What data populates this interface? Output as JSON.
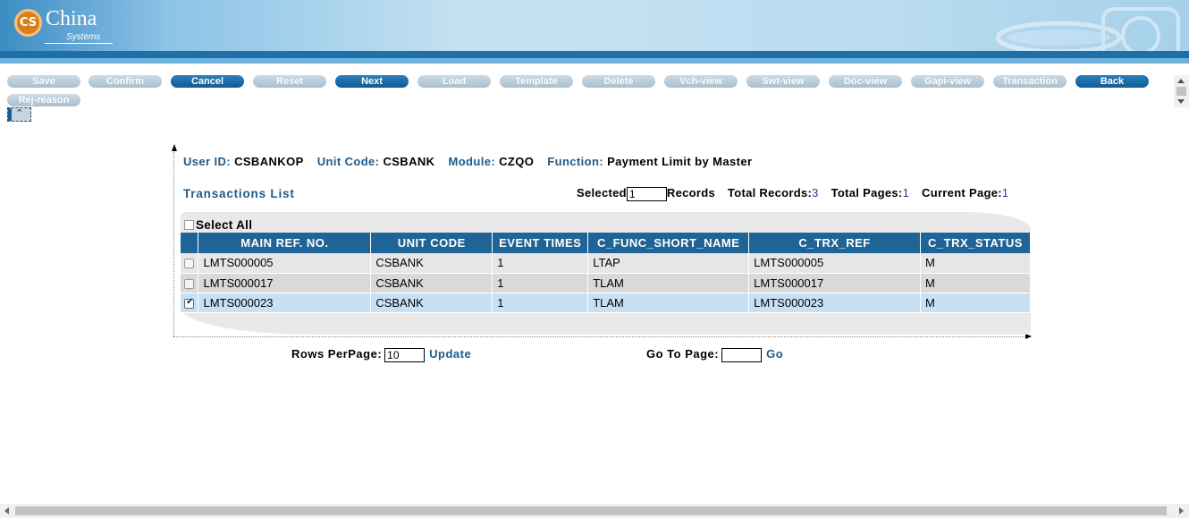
{
  "brand": {
    "badge_text": "CS",
    "name": "China",
    "sub": "Systems",
    "colors": {
      "banner_dark": "#1f6fa8",
      "banner_light": "#c6e2f2",
      "accent_orange": "#d87f1c"
    }
  },
  "toolbar": {
    "buttons": [
      {
        "label": "Save",
        "active": false
      },
      {
        "label": "Confirm",
        "active": false
      },
      {
        "label": "Cancel",
        "active": true
      },
      {
        "label": "Reset",
        "active": false
      },
      {
        "label": "Next",
        "active": true
      },
      {
        "label": "Load",
        "active": false
      },
      {
        "label": "Template",
        "active": false
      },
      {
        "label": "Delete",
        "active": false
      },
      {
        "label": "Vch-view",
        "active": false
      },
      {
        "label": "Swt-view",
        "active": false
      },
      {
        "label": "Doc-view",
        "active": false
      },
      {
        "label": "Gapi-view",
        "active": false
      },
      {
        "label": "Transaction",
        "active": false
      },
      {
        "label": "Back",
        "active": true
      },
      {
        "label": "Rej-reason",
        "active": false
      }
    ],
    "collapse_icon": "chevron-double-up-icon"
  },
  "info": {
    "user_id_label": "User ID:",
    "user_id": "CSBANKOP",
    "unit_code_label": "Unit Code:",
    "unit_code": "CSBANK",
    "module_label": "Module:",
    "module": "CZQO",
    "function_label": "Function:",
    "function": "Payment Limit by Master"
  },
  "list": {
    "title": "Transactions List",
    "selected_label": "Selected",
    "selected_value": "1",
    "records_label": "Records",
    "total_records_label": "Total Records:",
    "total_records": "3",
    "total_pages_label": "Total Pages:",
    "total_pages": "1",
    "current_page_label": "Current Page:",
    "current_page": "1",
    "select_all_label": "Select All",
    "columns": [
      "MAIN REF. NO.",
      "UNIT CODE",
      "EVENT TIMES",
      "C_FUNC_SHORT_NAME",
      "C_TRX_REF",
      "C_TRX_STATUS"
    ],
    "rows": [
      {
        "checked": false,
        "cells": [
          "LMTS000005",
          "CSBANK",
          "1",
          "LTAP",
          "LMTS000005",
          "M"
        ]
      },
      {
        "checked": false,
        "cells": [
          "LMTS000017",
          "CSBANK",
          "1",
          "TLAM",
          "LMTS000017",
          "M"
        ]
      },
      {
        "checked": true,
        "cells": [
          "LMTS000023",
          "CSBANK",
          "1",
          "TLAM",
          "LMTS000023",
          "M"
        ]
      }
    ]
  },
  "pager": {
    "rows_per_page_label": "Rows PerPage:",
    "rows_per_page_value": "10",
    "update_label": "Update",
    "go_to_page_label": "Go To Page:",
    "go_to_page_value": "",
    "go_label": "Go"
  }
}
